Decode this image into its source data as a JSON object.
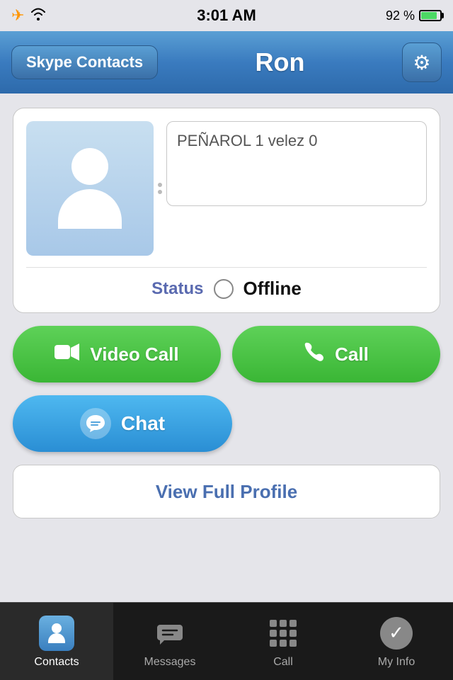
{
  "statusBar": {
    "time": "3:01 AM",
    "battery": "92 %"
  },
  "navBar": {
    "backLabel": "Skype Contacts",
    "title": "Ron",
    "gearLabel": "Settings"
  },
  "profile": {
    "statusMessage": "PEÑAROL 1 velez 0",
    "statusLabel": "Status",
    "statusValue": "Offline"
  },
  "buttons": {
    "videoCall": "Video Call",
    "call": "Call",
    "chat": "Chat",
    "viewFullProfile": "View Full Profile"
  },
  "tabBar": {
    "contacts": "Contacts",
    "messages": "Messages",
    "call": "Call",
    "myInfo": "My Info"
  }
}
